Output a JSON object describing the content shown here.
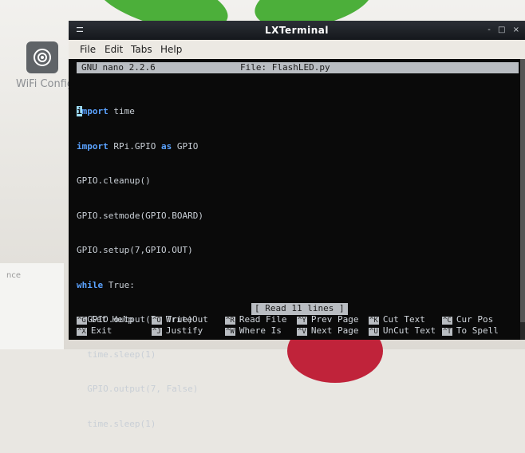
{
  "desktop": {
    "wifi_label": "WiFi Config",
    "side_text": "nce"
  },
  "window": {
    "title": "LXTerminal",
    "controls": "- □ ×",
    "menu": [
      {
        "label": "File"
      },
      {
        "label": "Edit"
      },
      {
        "label": "Tabs"
      },
      {
        "label": "Help"
      }
    ]
  },
  "nano": {
    "version": "GNU nano 2.2.6",
    "file": "File: FlashLED.py",
    "status": "[ Read 11 lines ]",
    "code_lines": [
      "import time",
      "import RPi.GPIO as GPIO",
      "GPIO.cleanup()",
      "GPIO.setmode(GPIO.BOARD)",
      "GPIO.setup(7,GPIO.OUT)",
      "while True:",
      "  GPIO.output(7, True)",
      "  time.sleep(1)",
      "  GPIO.output(7, False)",
      "  time.sleep(1)"
    ],
    "shortcuts": [
      {
        "key": "^G",
        "label": "Get Help"
      },
      {
        "key": "^O",
        "label": "WriteOut"
      },
      {
        "key": "^R",
        "label": "Read File"
      },
      {
        "key": "^Y",
        "label": "Prev Page"
      },
      {
        "key": "^K",
        "label": "Cut Text"
      },
      {
        "key": "^C",
        "label": "Cur Pos"
      },
      {
        "key": "^X",
        "label": "Exit"
      },
      {
        "key": "^J",
        "label": "Justify"
      },
      {
        "key": "^W",
        "label": "Where Is"
      },
      {
        "key": "^V",
        "label": "Next Page"
      },
      {
        "key": "^U",
        "label": "UnCut Text"
      },
      {
        "key": "^T",
        "label": "To Spell"
      }
    ]
  },
  "icons": [
    "wifi-config-icon",
    "terminal-menu-icon",
    "minimize-icon",
    "maximize-icon",
    "close-icon"
  ],
  "colors": {
    "terminal_bg": "#0a0a0a",
    "keyword": "#5aa2ff",
    "titlebar": "#15181c",
    "nano_bar": "#b9bdc2"
  }
}
